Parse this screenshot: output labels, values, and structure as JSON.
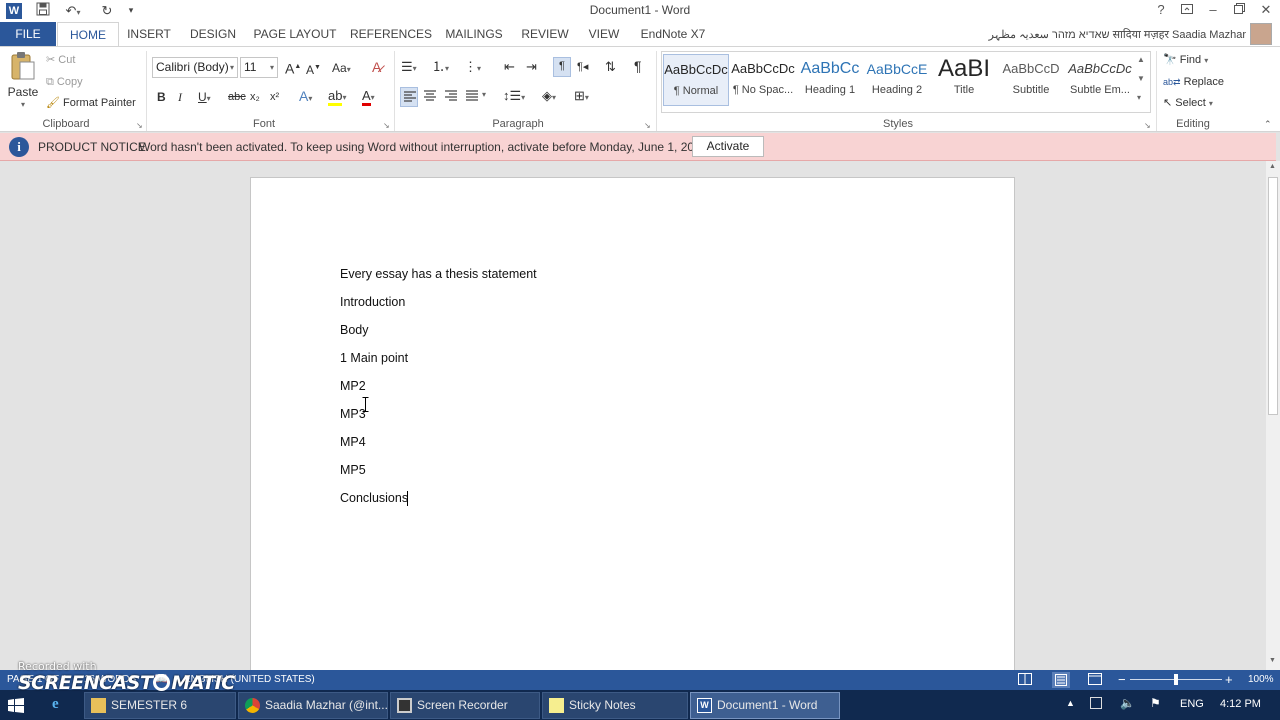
{
  "window": {
    "title": "Document1 - Word",
    "help": "?",
    "user": "שאדיא מזהר سعدیہ مظہر सादिया मज़हर Saadia Mazhar"
  },
  "tabs": [
    "FILE",
    "HOME",
    "INSERT",
    "DESIGN",
    "PAGE LAYOUT",
    "REFERENCES",
    "MAILINGS",
    "REVIEW",
    "VIEW",
    "EndNote X7"
  ],
  "clipboard": {
    "paste": "Paste",
    "cut": "Cut",
    "copy": "Copy",
    "format_painter": "Format Painter",
    "label": "Clipboard"
  },
  "font": {
    "name": "Calibri (Body)",
    "size": "11",
    "label": "Font",
    "bold": "B",
    "italic": "I",
    "underline": "U",
    "strike": "abc",
    "sub": "x₂",
    "sup": "x²",
    "grow": "A",
    "shrink": "A",
    "case": "Aa"
  },
  "paragraph": {
    "label": "Paragraph",
    "pilcrow": "¶"
  },
  "styles": {
    "label": "Styles",
    "items": [
      {
        "preview": "AaBbCcDc",
        "name": "¶ Normal"
      },
      {
        "preview": "AaBbCcDc",
        "name": "¶ No Spac..."
      },
      {
        "preview": "AaBbCc",
        "name": "Heading 1"
      },
      {
        "preview": "AaBbCcE",
        "name": "Heading 2"
      },
      {
        "preview": "AaBI",
        "name": "Title"
      },
      {
        "preview": "AaBbCcD",
        "name": "Subtitle"
      },
      {
        "preview": "AaBbCcDc",
        "name": "Subtle Em..."
      }
    ]
  },
  "editing": {
    "label": "Editing",
    "find": "Find",
    "replace": "Replace",
    "select": "Select"
  },
  "notice": {
    "title": "PRODUCT NOTICE",
    "message": "Word hasn't been activated. To keep using Word without interruption, activate before Monday, June 1, 2015.",
    "button": "Activate",
    "info_glyph": "i"
  },
  "document": {
    "paragraphs": [
      "Every essay has a thesis statement",
      "Introduction",
      "Body",
      "1 Main point",
      "MP2",
      "MP3",
      "MP4",
      "MP5",
      "Conclusions"
    ]
  },
  "status": {
    "page": "PAGE 1 OF 1",
    "words": "16 WORDS",
    "language": "ENGLISH (UNITED STATES)",
    "zoom": "100%",
    "zoom_minus": "−",
    "zoom_plus": "+"
  },
  "watermark": {
    "line1": "Recorded with",
    "line2": "SCREENCAST",
    "line3": "MATIC"
  },
  "taskbar": {
    "buttons": [
      {
        "label": "SEMESTER 6"
      },
      {
        "label": "Saadia Mazhar (@int..."
      },
      {
        "label": "Screen Recorder"
      },
      {
        "label": "Sticky Notes"
      },
      {
        "label": "Document1 - Word"
      }
    ],
    "lang": "ENG",
    "time": "4:12 PM"
  },
  "colors": {
    "accent": "#2b579a",
    "notice_bg": "#f8d3d3",
    "taskbar": "#10294f"
  }
}
